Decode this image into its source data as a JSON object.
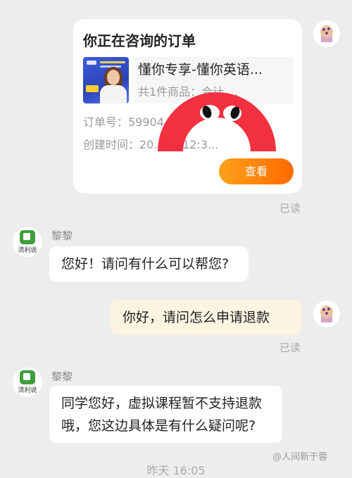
{
  "chat": {
    "top_timestamp": "—",
    "bottom_timestamp": "昨天 16:05"
  },
  "order_card": {
    "title": "你正在咨询的订单",
    "product_name": "懂你专享-懂你英语...",
    "product_summary": "共1件商品：合计 ...",
    "order_no": "订单号：59904...",
    "created_time": "创建时间：20...23 12:3...",
    "view_button": "查看"
  },
  "messages": [
    {
      "sender": "agent",
      "name": "黎黎",
      "text": "您好！请问有什么可以帮您?"
    },
    {
      "sender": "user",
      "text": "你好，请问怎么申请退款",
      "status": "已读"
    },
    {
      "sender": "agent",
      "name": "黎黎",
      "text_line1": "同学您好，虚拟课程暂不支持退款",
      "text_line2": "哦，您这边具体是有什么疑问呢?"
    }
  ],
  "read_status_1": "已读",
  "agent_avatar_caption": "流利说",
  "watermark": "@人间新于蓉",
  "colors": {
    "accent_orange": "#ff7a00",
    "mascot_red": "#f2303f",
    "user_bubble": "#fbf4e2"
  }
}
